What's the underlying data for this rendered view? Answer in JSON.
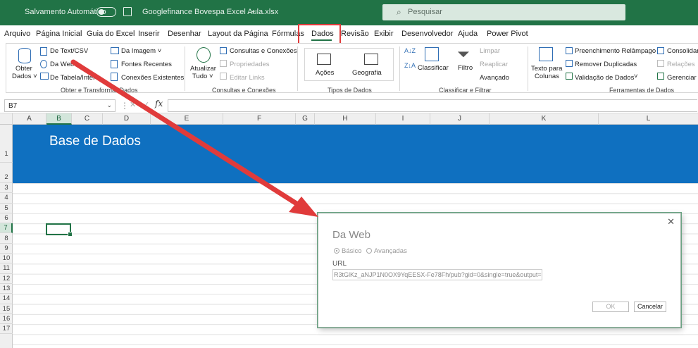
{
  "titlebar": {
    "autosave_label": "Salvamento Automático",
    "filename": "Googlefinance Bovespa Excel Aula.xlsx",
    "filename_caret": "⌄",
    "search_placeholder": "Pesquisar"
  },
  "menu": {
    "items": [
      "Arquivo",
      "Página Inicial",
      "Guia do Excel",
      "Inserir",
      "Desenhar",
      "Layout da Página",
      "Fórmulas",
      "Dados",
      "Revisão",
      "Exibir",
      "Desenvolvedor",
      "Ajuda",
      "Power Pivot"
    ],
    "active": "Dados"
  },
  "ribbon": {
    "get_data": {
      "obter_line1": "Obter",
      "obter_line2": "Dados ˅",
      "text_csv": "De Text/CSV",
      "web": "Da Web",
      "table": "De Tabela/Interv",
      "image": "Da Imagem ˅",
      "recent": "Fontes Recentes",
      "existing": "Conexões Existentes",
      "group_label": "Obter e Transformar Dados"
    },
    "queries": {
      "refresh_line1": "Atualizar",
      "refresh_line2": "Tudo ˅",
      "queries_connections": "Consultas e Conexões",
      "properties": "Propriedades",
      "edit_links": "Editar Links",
      "group_label": "Consultas e Conexões"
    },
    "data_types": {
      "stocks": "Ações",
      "geography": "Geografia",
      "group_label": "Tipos de Dados"
    },
    "sort_filter": {
      "sort": "Classificar",
      "filter": "Filtro",
      "clear": "Limpar",
      "reapply": "Reaplicar",
      "advanced": "Avançado",
      "group_label": "Classificar e Filtrar"
    },
    "tools": {
      "text_to_columns_line1": "Texto para",
      "text_to_columns_line2": "Colunas",
      "flash_fill": "Preenchimento Relâmpago",
      "remove_duplicates": "Remover Duplicadas",
      "validation": "Validação de Dados",
      "validation_caret": "˅",
      "consolidate": "Consolidar",
      "relations": "Relações",
      "manage": "Gerenciar M",
      "group_label": "Ferramentas de Dados"
    }
  },
  "formula_bar": {
    "name_box": "B7",
    "fx": "fx",
    "formula": ""
  },
  "sheet": {
    "columns": [
      "A",
      "B",
      "C",
      "D",
      "E",
      "F",
      "G",
      "H",
      "I",
      "J",
      "K",
      "L"
    ],
    "rows": [
      "1",
      "2",
      "3",
      "4",
      "5",
      "6",
      "7",
      "8",
      "9",
      "10",
      "11",
      "12",
      "13",
      "14",
      "15",
      "16",
      "17"
    ],
    "banner_title": "Base de Dados"
  },
  "dialog": {
    "title": "Da Web",
    "close": "✕",
    "radio_basic": "Básico",
    "radio_advanced": "Avançadas",
    "url_label": "URL",
    "url_value": "R3tGlKz_aNJP1N0OX9YqEESX-Fe78Fh/pub?gid=0&single=true&output=csv",
    "ok": "OK",
    "cancel": "Cancelar"
  },
  "colors": {
    "excel_green": "#217346",
    "banner_blue": "#0F70C0",
    "highlight_red": "#E03B3B"
  }
}
